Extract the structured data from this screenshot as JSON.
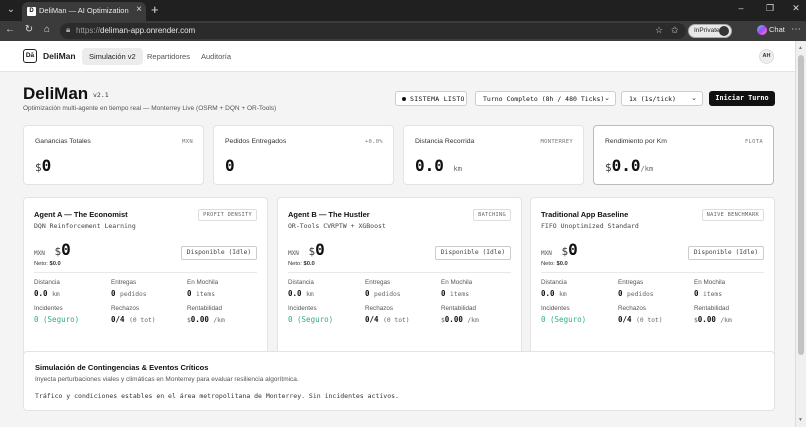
{
  "browser": {
    "tab_title": "DeliMan — AI Optimization Engine",
    "url_scheme": "https://",
    "url_host": "deliman-app.onrender.com",
    "inprivate_label": "InPrivate",
    "chat_label": "Chat"
  },
  "nav": {
    "logo_mark": "Dā",
    "logo_text": "DeliMan",
    "tabs": [
      "Simulación v2",
      "Repartidores",
      "Auditoría"
    ],
    "user_initials": "AH"
  },
  "header": {
    "title": "DeliMan",
    "version": "v2.1",
    "subtitle": "Optimización multi-agente en tiempo real — Monterrey Live (OSRM + DQN + OR-Tools)",
    "status": "SISTEMA LISTO",
    "shift_select": "Turno Completo (8h / 480 Ticks)",
    "speed_select": "1x (1s/tick)",
    "start_button": "Iniciar Turno"
  },
  "kpis": [
    {
      "label": "Ganancias Totales",
      "tag": "MXN",
      "prefix": "$",
      "value": "0",
      "unit": ""
    },
    {
      "label": "Pedidos Entregados",
      "tag": "+0.0%",
      "prefix": "",
      "value": "0",
      "unit": ""
    },
    {
      "label": "Distancia Recorrida",
      "tag": "MONTERREY",
      "prefix": "",
      "value": "0.0",
      "unit": "km"
    },
    {
      "label": "Rendimiento por Km",
      "tag": "FLOTA",
      "prefix": "$",
      "value": "0.0",
      "unit": "/km"
    }
  ],
  "agents": [
    {
      "name": "Agent A — The Economist",
      "tech": "DQN Reinforcement Learning",
      "tag": "PROFIT DENSITY",
      "currency": "MXN",
      "symbol": "$",
      "earnings": "0",
      "neto_label": "Neto:",
      "neto_value": "$0.0",
      "status": "Disponible (Idle)",
      "stats": {
        "distance_label": "Distancia",
        "distance_value": "0.0",
        "distance_unit": "km",
        "deliveries_label": "Entregas",
        "deliveries_value": "0",
        "deliveries_unit": "pedidos",
        "backpack_label": "En Mochila",
        "backpack_value": "0",
        "backpack_unit": "items",
        "incidents_label": "Incidentes",
        "incidents_value": "0 (Seguro)",
        "rejections_label": "Rechazos",
        "rejections_value": "0/4",
        "rejections_unit": "(0 tot)",
        "profit_label": "Rentabilidad",
        "profit_prefix": "$",
        "profit_value": "0.00",
        "profit_unit": "/km"
      }
    },
    {
      "name": "Agent B — The Hustler",
      "tech": "OR-Tools CVRPTW + XGBoost",
      "tag": "BATCHING",
      "currency": "MXN",
      "symbol": "$",
      "earnings": "0",
      "neto_label": "Neto:",
      "neto_value": "$0.0",
      "status": "Disponible (Idle)",
      "stats": {
        "distance_label": "Distancia",
        "distance_value": "0.0",
        "distance_unit": "km",
        "deliveries_label": "Entregas",
        "deliveries_value": "0",
        "deliveries_unit": "pedidos",
        "backpack_label": "En Mochila",
        "backpack_value": "0",
        "backpack_unit": "items",
        "incidents_label": "Incidentes",
        "incidents_value": "0 (Seguro)",
        "rejections_label": "Rechazos",
        "rejections_value": "0/4",
        "rejections_unit": "(0 tot)",
        "profit_label": "Rentabilidad",
        "profit_prefix": "$",
        "profit_value": "0.00",
        "profit_unit": "/km"
      }
    },
    {
      "name": "Traditional App Baseline",
      "tech": "FIFO Unoptimized Standard",
      "tag": "NAIVE BENCHMARK",
      "currency": "MXN",
      "symbol": "$",
      "earnings": "0",
      "neto_label": "Neto:",
      "neto_value": "$0.0",
      "status": "Disponible (Idle)",
      "stats": {
        "distance_label": "Distancia",
        "distance_value": "0.0",
        "distance_unit": "km",
        "deliveries_label": "Entregas",
        "deliveries_value": "0",
        "deliveries_unit": "pedidos",
        "backpack_label": "En Mochila",
        "backpack_value": "0",
        "backpack_unit": "items",
        "incidents_label": "Incidentes",
        "incidents_value": "0 (Seguro)",
        "rejections_label": "Rechazos",
        "rejections_value": "0/4",
        "rejections_unit": "(0 tot)",
        "profit_label": "Rentabilidad",
        "profit_prefix": "$",
        "profit_value": "0.00",
        "profit_unit": "/km"
      }
    }
  ],
  "contingency": {
    "title": "Simulación de Contingencias & Eventos Críticos",
    "subtitle": "Inyecta perturbaciones viales y climáticas en Monterrey para evaluar resiliencia algorítmica.",
    "message": "Tráfico y condiciones estables en el área metropolitana de Monterrey. Sin incidentes activos."
  }
}
